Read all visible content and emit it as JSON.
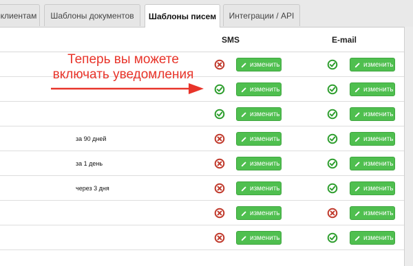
{
  "tabs": [
    {
      "label": "клиентам",
      "active": false
    },
    {
      "label": "Шаблоны документов",
      "active": false
    },
    {
      "label": "Шаблоны писем",
      "active": true
    },
    {
      "label": "Интеграции / API",
      "active": false
    }
  ],
  "table": {
    "columns": {
      "sms": "SMS",
      "email": "E-mail"
    },
    "edit_label": "изменить",
    "rows": [
      {
        "period": "",
        "sms_enabled": false,
        "email_enabled": true
      },
      {
        "period": "",
        "sms_enabled": true,
        "email_enabled": true
      },
      {
        "period": "",
        "sms_enabled": true,
        "email_enabled": true
      },
      {
        "period": "за 90 дней",
        "sms_enabled": false,
        "email_enabled": true
      },
      {
        "period": "за 1 день",
        "sms_enabled": false,
        "email_enabled": true
      },
      {
        "period": "через 3 дня",
        "sms_enabled": false,
        "email_enabled": true
      },
      {
        "period": "",
        "sms_enabled": false,
        "email_enabled": false
      },
      {
        "period": "",
        "sms_enabled": false,
        "email_enabled": true
      }
    ]
  },
  "annotation": {
    "text": "Теперь вы можете включать уведомления",
    "color": "#e8342a"
  },
  "colors": {
    "enabled": "#2e9e2e",
    "disabled": "#c0392b",
    "button": "#4fbf4f"
  }
}
